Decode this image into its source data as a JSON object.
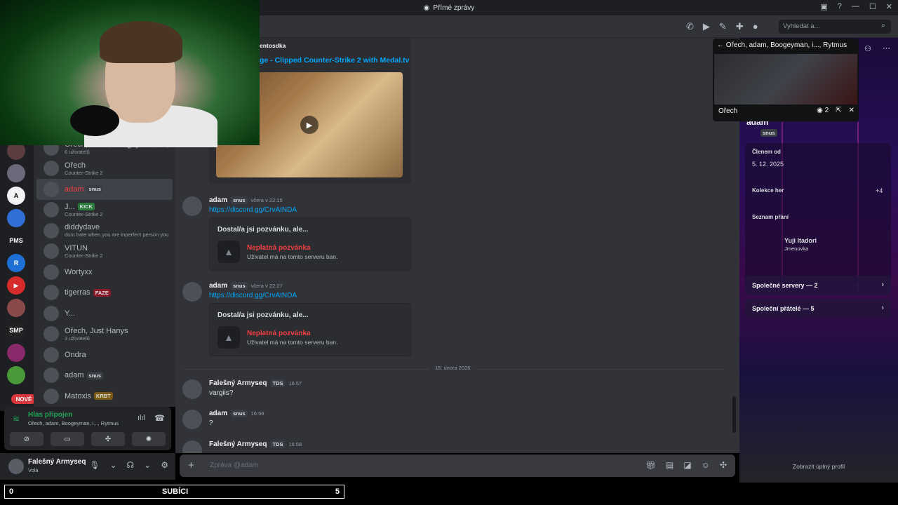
{
  "window": {
    "title": "Přímé zprávy",
    "controls": [
      "—",
      "☐",
      "✕"
    ]
  },
  "header": {
    "search_placeholder": "Vyhledat a..."
  },
  "dm_list": [
    {
      "name": "Ořech, adam, Boogeyman, i..., Rytmus",
      "sub": "6 uživatelů",
      "tag": ""
    },
    {
      "name": "Ořech",
      "sub": "Counter-Strike 2",
      "tag": ""
    },
    {
      "name": "adam",
      "sub": "",
      "tag": "snus"
    },
    {
      "name": "J...",
      "sub": "Counter-Strike 2",
      "tag": "KICK"
    },
    {
      "name": "diddydave",
      "sub": "dont hate when you are inperfect person you",
      "tag": ""
    },
    {
      "name": "VITUN",
      "sub": "Counter-Strike 2",
      "tag": ""
    },
    {
      "name": "Wortyxx",
      "sub": "",
      "tag": ""
    },
    {
      "name": "tigerras",
      "sub": "",
      "tag": "FAZE"
    },
    {
      "name": "Y...",
      "sub": "",
      "tag": ""
    },
    {
      "name": "Ořech, Just Hanys",
      "sub": "3 uživatelů",
      "tag": ""
    },
    {
      "name": "Ondra",
      "sub": "",
      "tag": ""
    },
    {
      "name": "adam",
      "sub": "",
      "tag": "snus"
    },
    {
      "name": "Matoxis",
      "sub": "",
      "tag": "KRBT"
    }
  ],
  "rail": {
    "new_badge": "NOVÉ",
    "notif": "1"
  },
  "voice": {
    "status": "Hlas připojen",
    "channel": "Ořech, adam, Boogeyman, i..., Rytmus"
  },
  "user": {
    "name": "Falešný Armyseq",
    "status": "Volá"
  },
  "chat": {
    "medal": {
      "author": "entosdka",
      "title": "ge - Clipped Counter-Strike 2 with Medal.tv"
    },
    "messages": [
      {
        "author": "adam",
        "tag": "snus",
        "time": "včera v 22:15",
        "body": "https://discord.gg/CrvAtNDA"
      },
      {
        "author": "adam",
        "tag": "snus",
        "time": "včera v 22:27",
        "body": "https://discord.gg/CrvAtNDA"
      },
      {
        "author": "Falešný Armyseq",
        "tag": "TDS",
        "time": "16:57",
        "body": "vargiis?"
      },
      {
        "author": "adam",
        "tag": "snus",
        "time": "16:58",
        "body": "?"
      },
      {
        "author": "Falešný Armyseq",
        "tag": "TDS",
        "time": "16:58",
        "body": ""
      }
    ],
    "invite": {
      "title": "Dostal/a jsi pozvánku, ale...",
      "invalid": "Neplatná pozvánka",
      "desc": "Uživatel má na tomto serveru ban."
    },
    "date_divider": "15. února 2026",
    "composer_placeholder": "Zpráva @adam"
  },
  "stream": {
    "title": "Ořech, adam, Boogeyman, i..., Rytmus",
    "name": "Ořech",
    "viewers": "2"
  },
  "profile": {
    "name": "adam",
    "tag": "snus",
    "member_since_label": "Členem od",
    "member_since": "5. 12. 2025",
    "games_label": "Kolekce her",
    "games_more": "+4",
    "wishlist_label": "Seznam přání",
    "wish_item": "Yuji Itadori",
    "wish_item_sub": "Jmenovka",
    "mutual_servers": "Společné servery — 2",
    "mutual_friends": "Společní přátelé — 5",
    "full_profile": "Zobrazit úplný profil"
  },
  "subbar": {
    "left": "0",
    "center": "SUBÍCI",
    "right": "5"
  }
}
